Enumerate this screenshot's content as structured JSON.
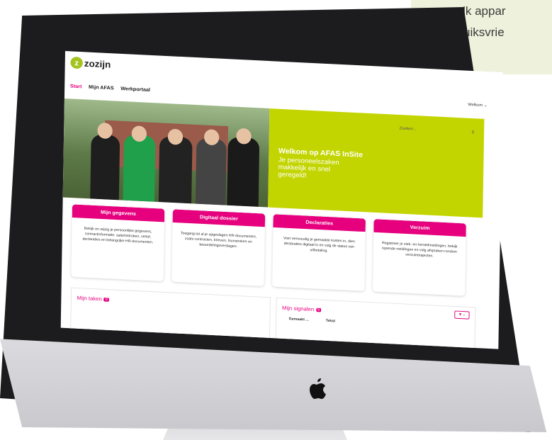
{
  "callout": {
    "line1": "op elk appar",
    "line2": "gebruiksvrie"
  },
  "app": {
    "logo_text": "zozijn",
    "nav": [
      "Start",
      "Mijn AFAS",
      "Werkportaal"
    ],
    "welcome": "Welkom",
    "search_placeholder": "Zoeken...",
    "hero": {
      "title": "Welkom op AFAS InSite",
      "subtitle": "Je personeelszaken makkelijk en snel geregeld!"
    },
    "cards": [
      {
        "title": "Mijn gegevens",
        "text": "Bekijk en wijzig je persoonlijke gegevens, contractinformatie, salarisstroken, verlof, declaraties en belangrijke HR-documenten."
      },
      {
        "title": "Digitaal dossier",
        "text": "Toegang tot al je opgeslagen HR-documenten, zoals contracten, brieven, loonstroken en beoordelingsverslagen."
      },
      {
        "title": "Declaraties",
        "text": "Voer eenvoudig je gemaakte kosten in, dien declaraties digitaal in en volg de status van uitbetaling."
      },
      {
        "title": "Verzuim",
        "text": "Registreer je ziek- en herstelmeldingen, bekijk lopende meldingen en volg afspraken rondom verzuimtrajecten."
      }
    ],
    "tasks": {
      "title": "Mijn taken",
      "count": "0"
    },
    "signals": {
      "title": "Mijn signalen",
      "count": "5",
      "columns": [
        "Gemaakt ...",
        "Tekst"
      ]
    }
  },
  "colors": {
    "brand_green": "#c3d500",
    "accent_pink": "#e6007e"
  }
}
